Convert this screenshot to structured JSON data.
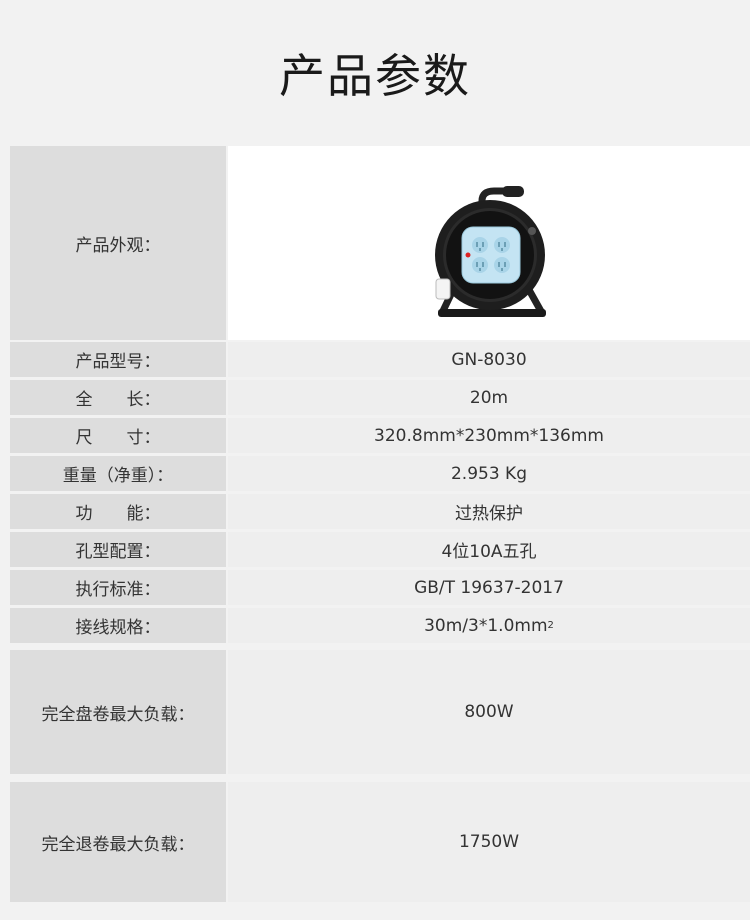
{
  "title": "产品参数",
  "appearance_label": "产品外观：",
  "specs": [
    {
      "label": "产品型号：",
      "value": "GN-8030"
    },
    {
      "label": "全　　长：",
      "value": "20m"
    },
    {
      "label": "尺　　寸：",
      "value": "320.8mm*230mm*136mm"
    },
    {
      "label": "重量（净重）：",
      "value": "2.953 Kg"
    },
    {
      "label": "功　　能：",
      "value": "过热保护"
    },
    {
      "label": "孔型配置：",
      "value": "4位10A五孔"
    },
    {
      "label": "执行标准：",
      "value": "GB/T 19637-2017"
    },
    {
      "label": "接线规格：",
      "value_main": "30m/3*1.0mm",
      "value_sup": "2"
    },
    {
      "label": "完全盘卷最大负载：",
      "value": "800W"
    },
    {
      "label": "完全退卷最大负载：",
      "value": "1750W"
    }
  ],
  "colors": {
    "label_bg": "#dddddd",
    "value_bg": "#eeeeee",
    "socket_blue": "#bfe3f2",
    "reel_body": "#222222"
  }
}
